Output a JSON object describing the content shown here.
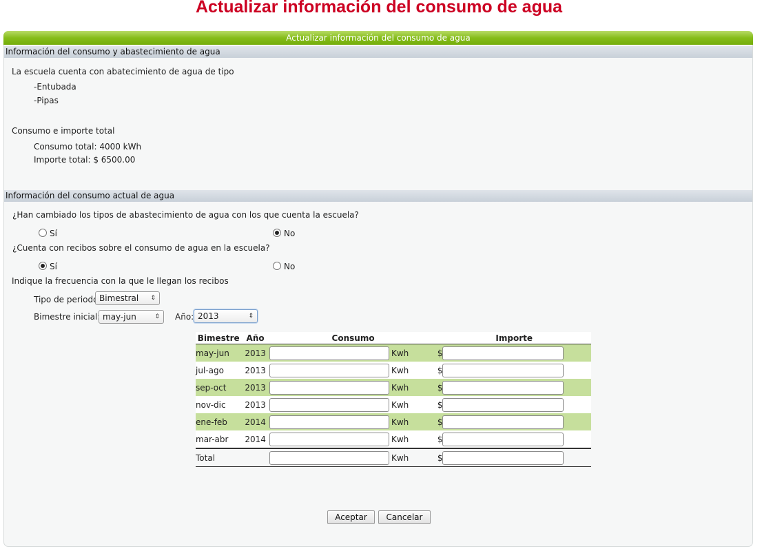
{
  "page_title": "Actualizar información del consumo de agua",
  "panel_header": "Actualizar información del consumo de agua",
  "section1": {
    "title": "Información del consumo y abastecimiento de agua",
    "supply_intro": "La escuela cuenta con abatecimiento de agua de tipo",
    "supply_types": [
      "-Entubada",
      "-Pipas"
    ],
    "consumo_heading": "Consumo e importe total",
    "consumo_total": "Consumo total: 4000  kWh",
    "importe_total": "Importe total: $ 6500.00"
  },
  "section2": {
    "title": "Información del consumo actual de agua",
    "q1": "¿Han cambiado los tipos de abastecimiento de agua con los que cuenta la escuela?",
    "q1_yes": "Sí",
    "q1_no": "No",
    "q2": "¿Cuenta con recibos sobre el consumo de agua en la escuela?",
    "q2_yes": "Sí",
    "q2_no": "No",
    "freq_label": "Indique la frecuencia con la que le llegan los recibos",
    "tipo_periodo_label": "Tipo de periodo",
    "tipo_periodo_value": "Bimestral",
    "bimestre_inicial_label": "Bimestre inicial:",
    "bimestre_inicial_value": "may-jun",
    "anio_label": "Año:",
    "anio_value": "2013"
  },
  "table": {
    "headers": [
      "Bimestre",
      "Año",
      "Consumo",
      "Importe"
    ],
    "rows": [
      {
        "bimestre": "may-jun",
        "anio": "2013",
        "unit": "Kwh",
        "currency": "$"
      },
      {
        "bimestre": "jul-ago",
        "anio": "2013",
        "unit": "Kwh",
        "currency": "$"
      },
      {
        "bimestre": "sep-oct",
        "anio": "2013",
        "unit": "Kwh",
        "currency": "$"
      },
      {
        "bimestre": "nov-dic",
        "anio": "2013",
        "unit": "Kwh",
        "currency": "$"
      },
      {
        "bimestre": "ene-feb",
        "anio": "2014",
        "unit": "Kwh",
        "currency": "$"
      },
      {
        "bimestre": "mar-abr",
        "anio": "2014",
        "unit": "Kwh",
        "currency": "$"
      }
    ],
    "total_label": "Total",
    "total_unit": "Kwh",
    "total_currency": "$"
  },
  "buttons": {
    "accept": "Aceptar",
    "cancel": "Cancelar"
  },
  "colors": {
    "title_red": "#cc0022",
    "header_green": "#86bd1a",
    "row_green": "#c6df9c"
  }
}
